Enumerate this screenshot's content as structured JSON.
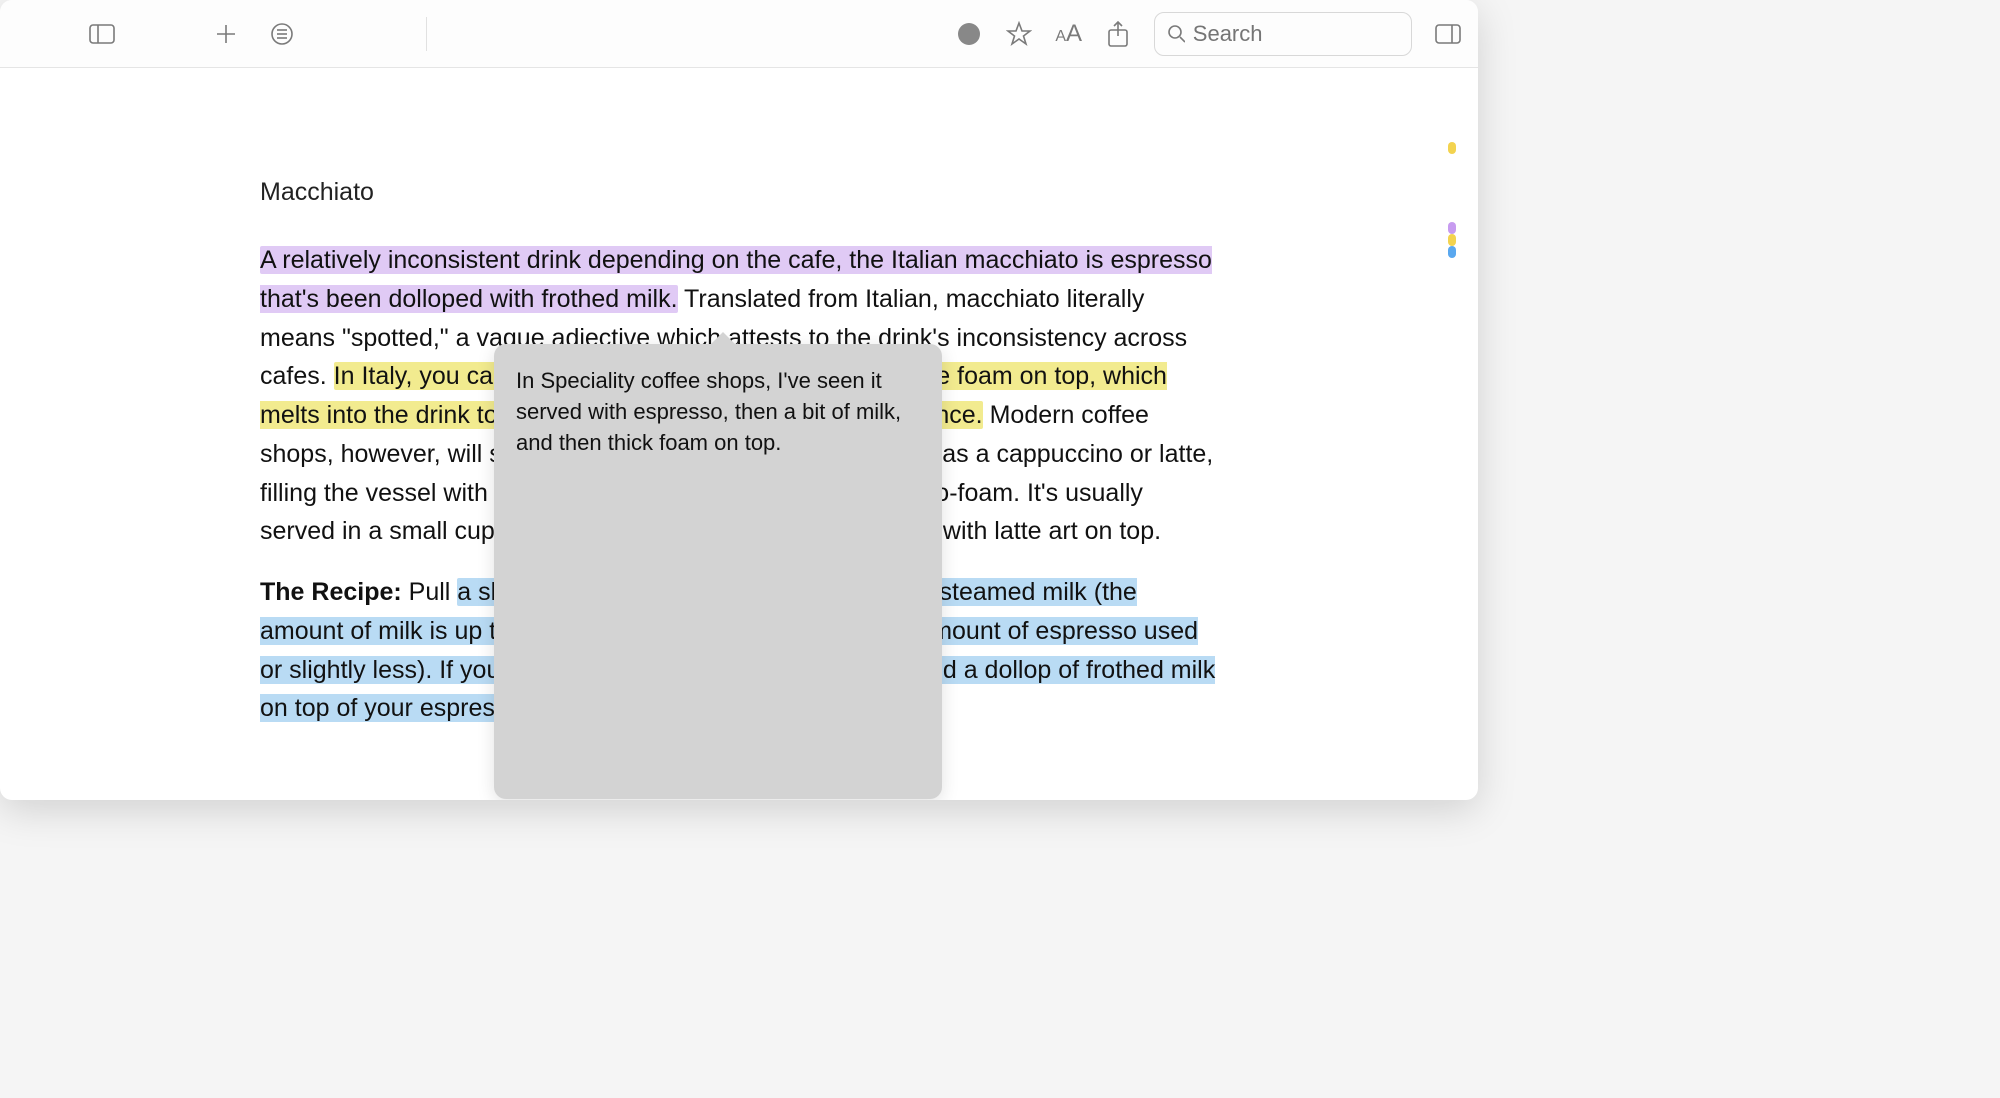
{
  "search": {
    "placeholder": "Search"
  },
  "colors": {
    "purple": "#e0caf5",
    "yellow": "#f2eb8f",
    "blue": "#b9dbf4"
  },
  "doc": {
    "title": "Macchiato",
    "p1": {
      "s1_hl_purple": "A relatively inconsistent drink depending on the cafe, the Italian macchiato is espresso that's been dolloped with frothed milk.",
      "s2_plain": " Translated from Italian, macchiato literally means \"spotted,\" a vague adjective which attests to the drink's inconsistency across cafes. ",
      "s3_hl_yellow": "In Italy, you can expect a shot of espresso with a simple foam on top, which melts into the drink to slightly sweeten and soften the experience.",
      "s4_plain": " Modern coffee shops, however, will steam and add milk much the same way as a cappuccino or latte, filling the vessel with a combination of steamed milk and micro-foam. It's usually served in a small cup, and it's not uncommon to see it served with latte art on top."
    },
    "p2": {
      "label": "The Recipe:",
      "s1_plain": " Pull ",
      "s2_hl_blue": "a shot of espresso into a cup, then top with steamed milk (the amount of milk is up to interpretation, but roughly the same amount of espresso used or slightly less). If you're aiming for a traditional macchiato, add a dollop of frothed milk on top of your espresso."
    }
  },
  "note": {
    "text": "In Speciality coffee shops, I've seen it served with espresso, then a bit of milk, and then thick foam on top."
  }
}
